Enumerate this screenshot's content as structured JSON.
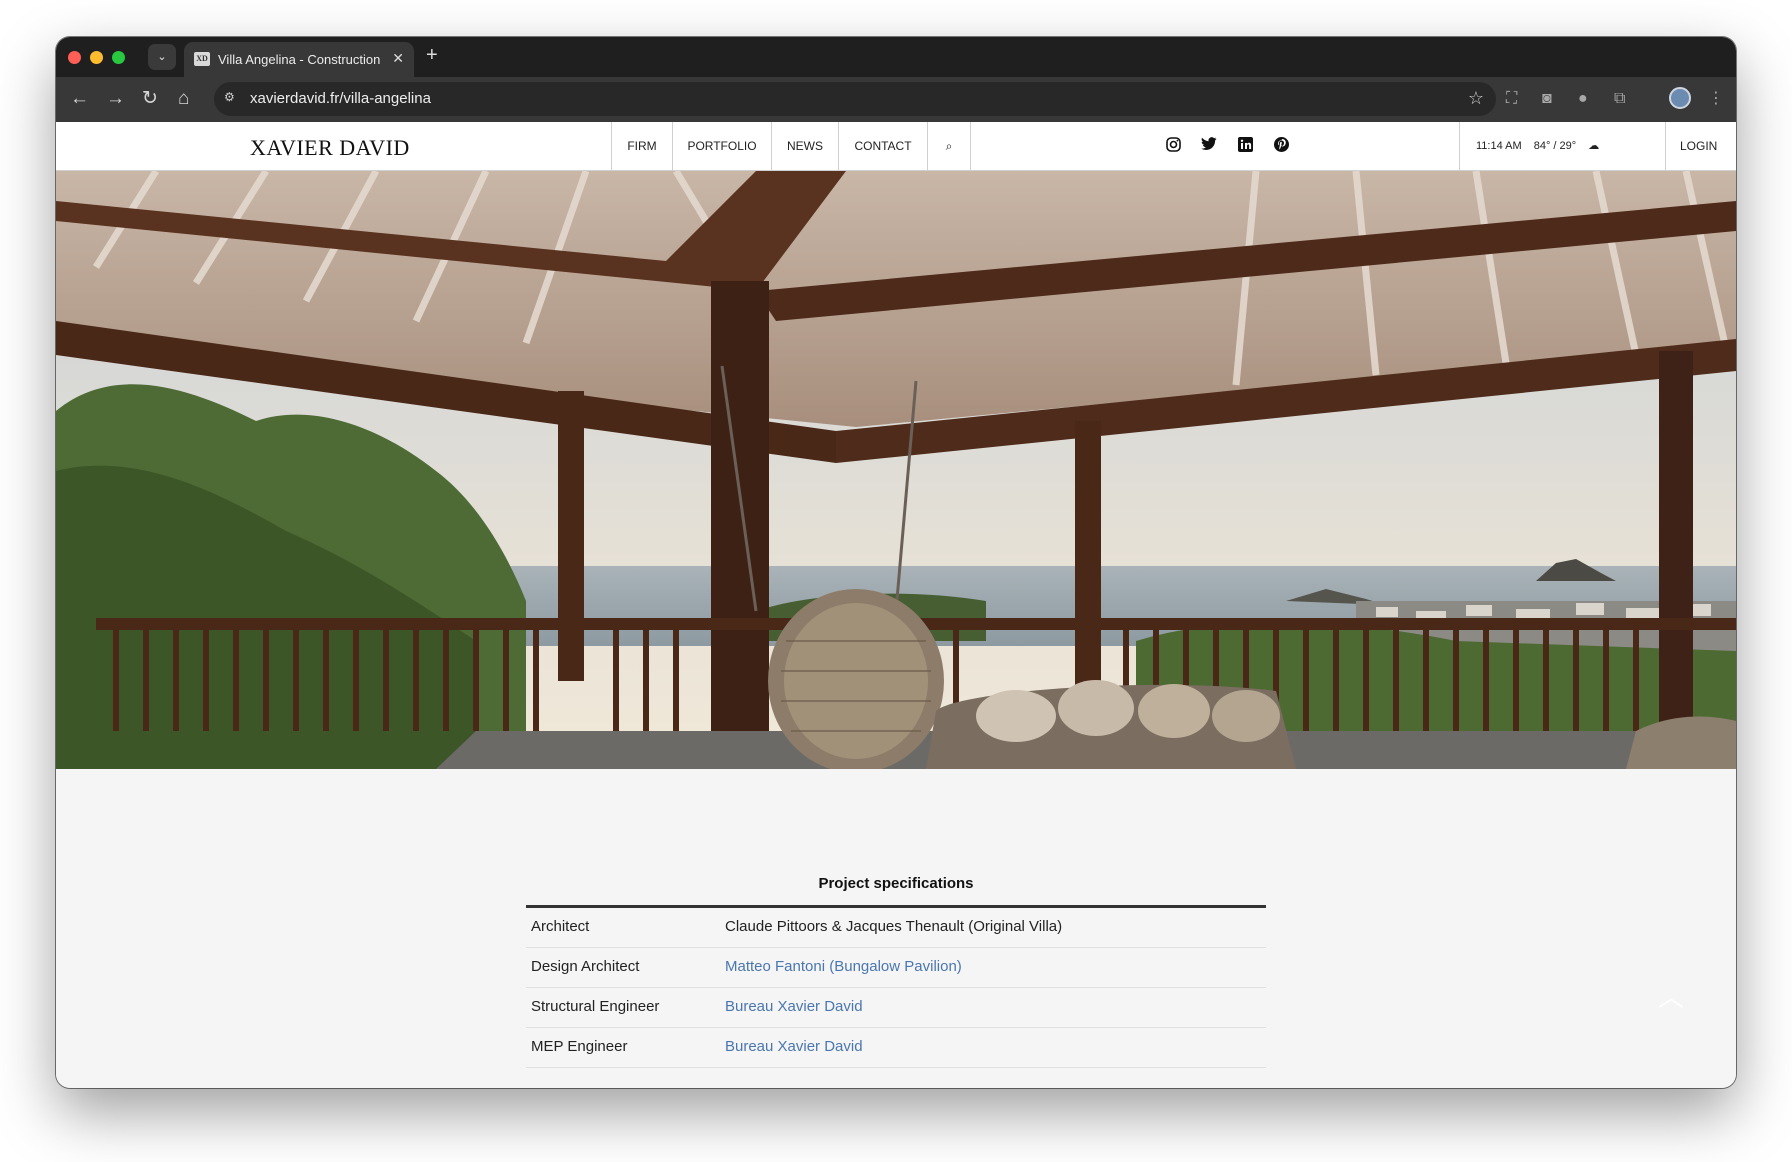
{
  "browser": {
    "tab": {
      "favicon": "XD",
      "title": "Villa Angelina - Construction",
      "close_glyph": "✕"
    },
    "new_tab_glyph": "+",
    "tab_list_glyph": "⌄",
    "url": "xavierdavid.fr/villa-angelina",
    "icons": [
      "back-icon",
      "forward-icon",
      "reload-icon",
      "home-icon",
      "site-info-icon",
      "bookmark-star-icon",
      "screenshot-icon",
      "camera-icon",
      "extension-circle-icon",
      "puzzle-icon",
      "profile-avatar",
      "menu-dots-icon"
    ]
  },
  "site": {
    "logo": "XAVIER DAVID",
    "nav": [
      "FIRM",
      "PORTFOLIO",
      "NEWS",
      "CONTACT"
    ],
    "search_icon": "search-icon",
    "social": [
      "instagram-icon",
      "twitter-icon",
      "linkedin-icon",
      "pinterest-icon"
    ],
    "time": "11:14 AM",
    "temp": "84° / 29°",
    "weather_icon": "partly-cloudy-icon",
    "login": "LOGIN"
  },
  "hero": {
    "image": "villa-veranda-ocean-view"
  },
  "specs": {
    "title": "Project specifications",
    "rows": [
      {
        "label": "Architect",
        "value": "Claude Pittoors & Jacques Thenault (Original Villa)",
        "link": false
      },
      {
        "label": "Design Architect",
        "value": "Matteo Fantoni (Bungalow Pavilion)",
        "link": true
      },
      {
        "label": "Structural Engineer",
        "value": "Bureau Xavier David",
        "link": true
      },
      {
        "label": "MEP Engineer",
        "value": "Bureau Xavier David",
        "link": true
      }
    ]
  },
  "colors": {
    "link": "#4a76b0",
    "chrome_dark": "#1f1f1f",
    "chrome_toolbar": "#383838"
  }
}
